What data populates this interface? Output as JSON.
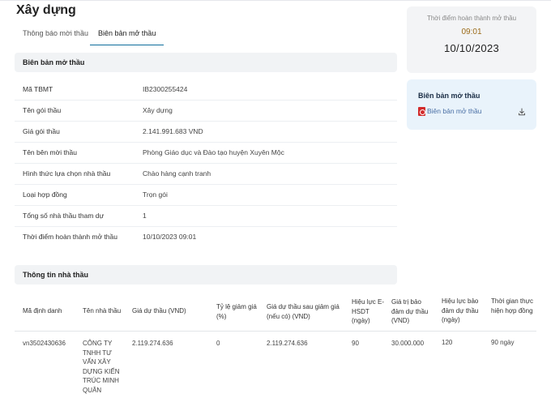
{
  "page": {
    "title": "Xây dựng"
  },
  "tabs": [
    {
      "label": "Thông báo mời thầu",
      "active": false
    },
    {
      "label": "Biên bản mở thầu",
      "active": true
    }
  ],
  "sections": {
    "opening_record": "Biên bản mở thầu",
    "bidder_info": "Thông tin nhà thầu"
  },
  "info_rows": [
    {
      "label": "Mã TBMT",
      "value": "IB2300255424"
    },
    {
      "label": "Tên gói thầu",
      "value": "Xây dựng"
    },
    {
      "label": "Giá gói thầu",
      "value": "2.141.991.683 VND"
    },
    {
      "label": "Tên bên mời thầu",
      "value": "Phòng Giáo dục và Đào tạo huyện Xuyên Mộc"
    },
    {
      "label": "Hình thức lựa chọn nhà thầu",
      "value": "Chào hàng cạnh tranh"
    },
    {
      "label": "Loại hợp đồng",
      "value": "Trọn gói"
    },
    {
      "label": "Tổng số nhà thầu tham dự",
      "value": "1"
    },
    {
      "label": "Thời điểm hoàn thành mở thầu",
      "value": "10/10/2023 09:01"
    }
  ],
  "bidder_table": {
    "headers": [
      "Mã định danh",
      "Tên nhà thầu",
      "Giá dự thầu (VND)",
      "Tỷ lệ giảm giá (%)",
      "Giá dự thầu sau giảm giá (nếu có) (VND)",
      "Hiệu lực E-HSDT (ngày)",
      "Giá trị bảo đảm dự thầu (VND)",
      "Hiệu lực bảo đảm dự thầu (ngày)",
      "Thời gian thực hiện hợp đồng"
    ],
    "rows": [
      {
        "id": "vn3502430636",
        "name": "CÔNG TY TNHH TƯ VẤN XÂY DỰNG KIẾN TRÚC MINH QUÂN",
        "bid_price": "2.119.274.636",
        "discount": "0",
        "price_after_discount": "2.119.274.636",
        "validity": "90",
        "guarantee_value": "30.000.000",
        "guarantee_validity": "120",
        "duration": "90 ngày"
      }
    ]
  },
  "completion_card": {
    "label": "Thời điểm hoàn thành mở thầu",
    "time": "09:01",
    "date": "10/10/2023"
  },
  "record_card": {
    "title": "Biên bản mở thầu",
    "file_label": "Biên bản mở thầu",
    "file_icon": "pdf-icon",
    "action_icon": "download-icon"
  },
  "colors": {
    "accent": "#0e6d9c",
    "time_text": "#9a6a18",
    "link": "#4a6fa5",
    "pdf": "#d22b2b",
    "card_bg": "#f3f4f6",
    "record_card_bg": "#e9f3fb"
  }
}
